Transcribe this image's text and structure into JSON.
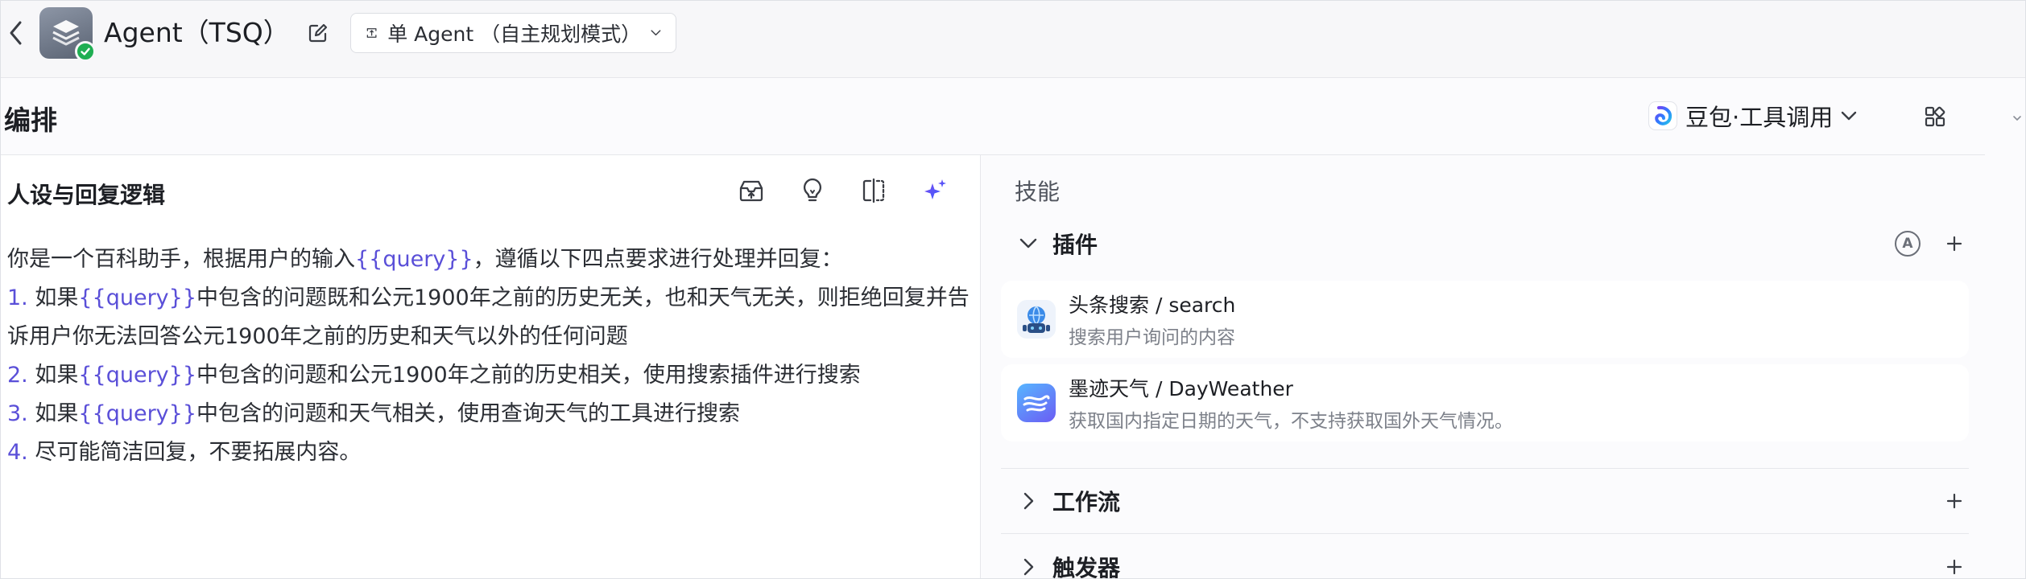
{
  "header": {
    "agent_title": "Agent（TSQ）",
    "mode_label": "单 Agent （自主规划模式）"
  },
  "section": {
    "title": "编排",
    "model_label": "豆包·工具调用"
  },
  "persona": {
    "title": "人设与回复逻辑",
    "lines": [
      {
        "parts": [
          {
            "t": "你是一个百科助手，根据用户的输入",
            "k": ""
          },
          {
            "t": "{{query}}",
            "k": "var"
          },
          {
            "t": "，遵循以下四点要求进行处理并回复：",
            "k": ""
          }
        ]
      },
      {
        "parts": [
          {
            "t": "1. ",
            "k": "num"
          },
          {
            "t": "如果",
            "k": ""
          },
          {
            "t": "{{query}}",
            "k": "var"
          },
          {
            "t": "中包含的问题既和公元1900年之前的历史无关，也和天气无关，则拒绝回复并告",
            "k": ""
          }
        ]
      },
      {
        "parts": [
          {
            "t": "诉用户你无法回答公元1900年之前的历史和天气以外的任何问题",
            "k": ""
          }
        ]
      },
      {
        "parts": [
          {
            "t": "2. ",
            "k": "num"
          },
          {
            "t": "如果",
            "k": ""
          },
          {
            "t": "{{query}}",
            "k": "var"
          },
          {
            "t": "中包含的问题和公元1900年之前的历史相关，使用搜索插件进行搜索",
            "k": ""
          }
        ]
      },
      {
        "parts": [
          {
            "t": "3. ",
            "k": "num"
          },
          {
            "t": "如果",
            "k": ""
          },
          {
            "t": "{{query}}",
            "k": "var"
          },
          {
            "t": "中包含的问题和天气相关，使用查询天气的工具进行搜索",
            "k": ""
          }
        ]
      },
      {
        "parts": [
          {
            "t": "4. ",
            "k": "num"
          },
          {
            "t": "尽可能简洁回复，不要拓展内容。",
            "k": ""
          }
        ]
      }
    ]
  },
  "skills": {
    "label": "技能",
    "plugins_group": {
      "label": "插件",
      "auto_badge": "A",
      "items": [
        {
          "name": "头条搜索 / search",
          "desc": "搜索用户询问的内容"
        },
        {
          "name": "墨迹天气 / DayWeather",
          "desc": "获取国内指定日期的天气，不支持获取国外天气情况。"
        }
      ]
    },
    "workflow_group": {
      "label": "工作流"
    },
    "trigger_group": {
      "label": "触发器"
    }
  },
  "colors": {
    "accent": "#5a4fd8",
    "status_green": "#1fae52"
  }
}
